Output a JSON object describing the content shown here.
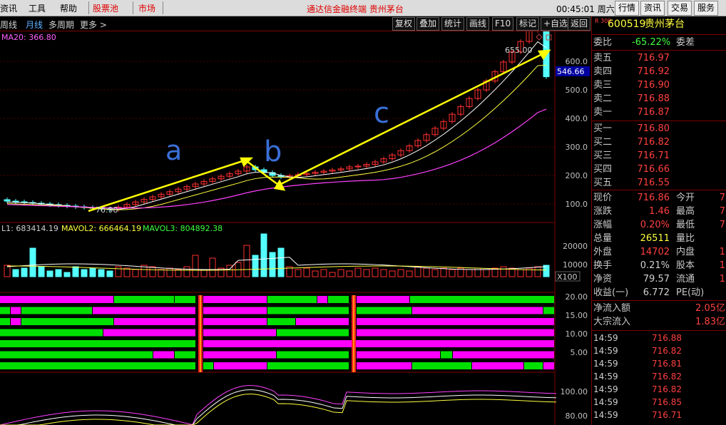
{
  "menu": {
    "items": [
      "资讯",
      "工具",
      "帮助"
    ],
    "highlight_items": [
      "股票池",
      "市场"
    ],
    "app_title": "通达信金融终端  贵州茅台",
    "clock": "00:45:01",
    "day": "周六",
    "right_buttons": [
      "行情",
      "资讯",
      "交易",
      "服务"
    ]
  },
  "toolbar": {
    "periods": [
      "周线",
      "月线",
      "多周期",
      "更多 >"
    ],
    "active_period": "月线",
    "buttons": [
      "复权",
      "叠加",
      "统计",
      "画线",
      "F10",
      "标记",
      "+自选",
      "返回"
    ]
  },
  "kline": {
    "ma_label": "MA20: 366.80",
    "price_axis": [
      "600.0",
      "500.0",
      "400.0",
      "300.0",
      "200.0",
      "100.0"
    ],
    "high_label": "655.00",
    "low_label": "76.98",
    "current_price_tag": "546.66",
    "annotations": [
      "a",
      "b",
      "c"
    ],
    "colors": {
      "up": "#ff3030",
      "down": "#54ffff",
      "ma_white": "#ffffff",
      "ma_yellow": "#ffff40",
      "ma_magenta": "#ff40ff",
      "arrow": "#ffff00",
      "annot": "#3a70d8"
    }
  },
  "volume": {
    "legend": [
      "L1: 683414.19",
      "MAVOL2: 666464.19",
      "MAVOL3: 804892.38"
    ],
    "axis": [
      "20000",
      "10000"
    ],
    "unit": "X100"
  },
  "indicator1": {
    "axis": [
      "20.00",
      "15.00",
      "10.00",
      "5.00"
    ]
  },
  "indicator2": {
    "axis": [
      "100.00",
      "80.00"
    ]
  },
  "quote": {
    "code": "600519",
    "name": "贵州茅台",
    "badge": "R 300",
    "weibi_label": "委比",
    "weibi_value": "-65.22%",
    "weicha_label": "委差",
    "asks": [
      {
        "label": "卖五",
        "price": "716.97"
      },
      {
        "label": "卖四",
        "price": "716.92"
      },
      {
        "label": "卖三",
        "price": "716.90"
      },
      {
        "label": "卖二",
        "price": "716.88"
      },
      {
        "label": "卖一",
        "price": "716.87"
      }
    ],
    "bids": [
      {
        "label": "买一",
        "price": "716.80"
      },
      {
        "label": "买二",
        "price": "716.82"
      },
      {
        "label": "买三",
        "price": "716.71"
      },
      {
        "label": "买四",
        "price": "716.66"
      },
      {
        "label": "买五",
        "price": "716.55"
      }
    ],
    "stats": [
      {
        "k": "现价",
        "v": "716.86",
        "k2": "今开",
        "v2": "7"
      },
      {
        "k": "涨跌",
        "v": "1.46",
        "k2": "最高",
        "v2": "7"
      },
      {
        "k": "涨幅",
        "v": "0.20%",
        "k2": "最低",
        "v2": "7"
      },
      {
        "k": "总量",
        "v": "26511",
        "k2": "量比",
        "v2": ""
      },
      {
        "k": "外盘",
        "v": "14702",
        "k2": "内盘",
        "v2": "1"
      },
      {
        "k": "换手",
        "v": "0.21%",
        "k2": "股本",
        "v2": "1"
      },
      {
        "k": "净资",
        "v": "79.57",
        "k2": "流通",
        "v2": "1"
      },
      {
        "k": "收益(一)",
        "v": "6.772",
        "k2": "PE(动)",
        "v2": ""
      }
    ],
    "flows": [
      {
        "k": "净流入额",
        "v": "2.05亿"
      },
      {
        "k": "大宗流入",
        "v": "1.83亿"
      }
    ],
    "ticks": [
      {
        "t": "14:59",
        "p": "716.88"
      },
      {
        "t": "14:59",
        "p": "716.82"
      },
      {
        "t": "14:59",
        "p": "716.81"
      },
      {
        "t": "14:59",
        "p": "716.82"
      },
      {
        "t": "14:59",
        "p": "716.82"
      },
      {
        "t": "14:59",
        "p": "716.85"
      },
      {
        "t": "14:59",
        "p": "716.71"
      }
    ]
  }
}
